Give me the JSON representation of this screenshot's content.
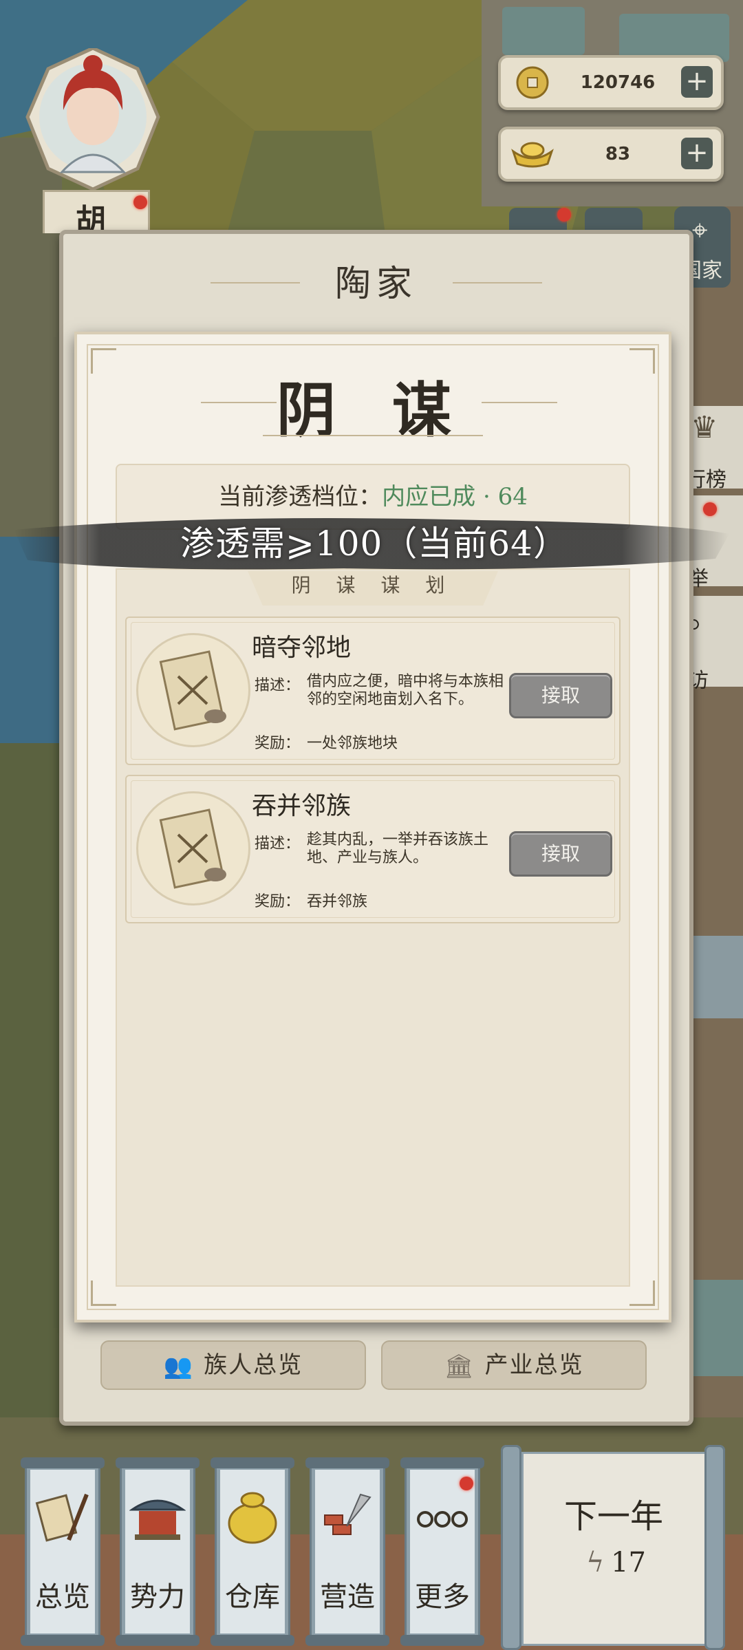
{
  "hud": {
    "coins": "120746",
    "gold": "83",
    "player_surname": "胡"
  },
  "family_panel": {
    "title": "陶家",
    "buttons": [
      "族人总览",
      "产业总览"
    ]
  },
  "side_buttons": {
    "family_label": "国家",
    "ranking_label": "行榜",
    "recommend_label": "举",
    "visit_label": "访"
  },
  "intrigue": {
    "title": "阴 谋",
    "level_label": "当前渗透档位：",
    "level_value": "内应已成 · 64",
    "banner": "渗透需⩾100（当前64）",
    "section_tab": "阴 谋 谋 划",
    "tasks": [
      {
        "name": "暗夺邻地",
        "desc_label": "描述：",
        "desc": "借内应之便，暗中将与本族相邻的空闲地亩划入名下。",
        "reward_label": "奖励：",
        "reward": "一处邻族地块",
        "action": "接取"
      },
      {
        "name": "吞并邻族",
        "desc_label": "描述：",
        "desc": "趁其内乱，一举并吞该族土地、产业与族人。",
        "reward_label": "奖励：",
        "reward": "吞并邻族",
        "action": "接取"
      }
    ]
  },
  "bottom_nav": {
    "items": [
      "总览",
      "势力",
      "仓库",
      "营造",
      "更多"
    ],
    "next_year": "下一年",
    "energy": "17"
  },
  "colors": {
    "level_value": "#4f8a5c",
    "accept_button": "#8c8b8a",
    "nav_tube": "#8ea0aa",
    "notification_dot": "#d43a2f"
  }
}
